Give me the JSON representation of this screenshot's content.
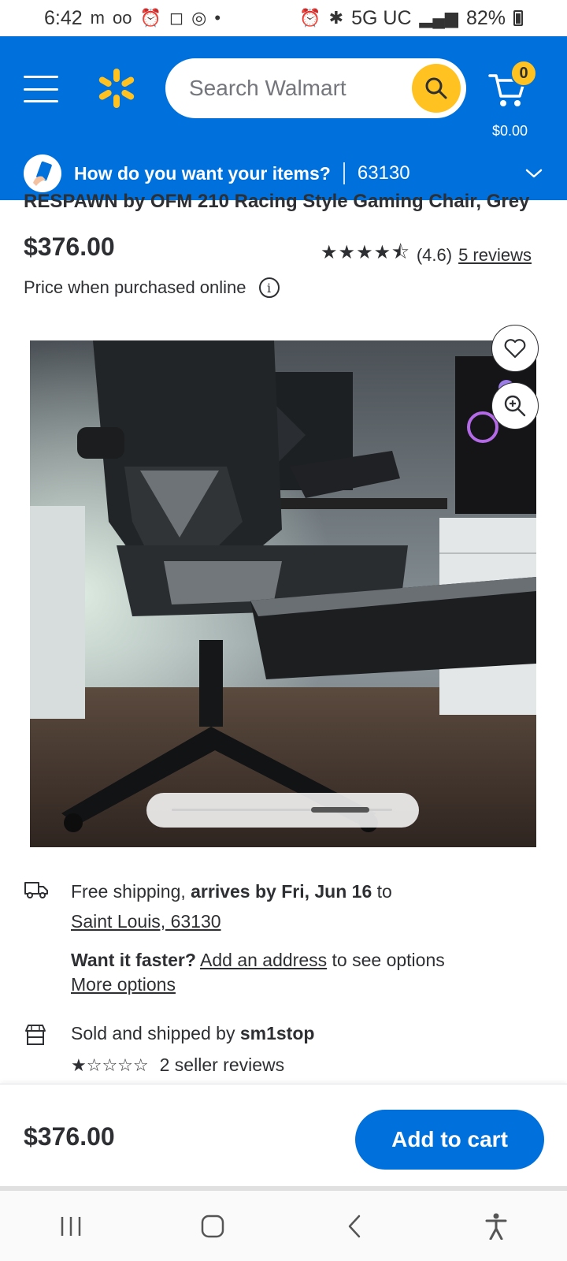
{
  "status_bar": {
    "time": "6:42",
    "left_icons": [
      "carrier-icon",
      "voicemail-icon",
      "alarm-icon",
      "instagram-icon",
      "chrome-icon",
      "dot-icon"
    ],
    "network": "5G UC",
    "battery": "82%"
  },
  "header": {
    "search_placeholder": "Search Walmart",
    "cart_count": "0",
    "cart_total": "$0.00",
    "brand_color": "#0071dc",
    "accent_color": "#ffc220"
  },
  "delivery": {
    "question": "How do you want your items?",
    "zip": "63130"
  },
  "product": {
    "title": "RESPAWN by OFM 210 Racing Style Gaming Chair, Grey",
    "price": "$376.00",
    "rating_text": "(4.6)",
    "rating_value": 4.6,
    "reviews_link": "5 reviews",
    "price_note": "Price when purchased online"
  },
  "fulfillment": {
    "shipping_prefix": "Free shipping, ",
    "shipping_bold": "arrives by Fri, Jun 16",
    "shipping_suffix": " to",
    "location_link": "Saint Louis, 63130",
    "faster_bold": "Want it faster?",
    "add_address_link": "Add an address",
    "faster_suffix": " to see options",
    "more_options": "More options",
    "seller_prefix": "Sold and shipped by ",
    "seller_name": "sm1stop",
    "seller_rating_value": 1,
    "seller_reviews": "2 seller reviews"
  },
  "sticky_footer": {
    "price": "$376.00",
    "add_to_cart": "Add to cart"
  },
  "carousel": {
    "position_fraction": 0.86
  }
}
